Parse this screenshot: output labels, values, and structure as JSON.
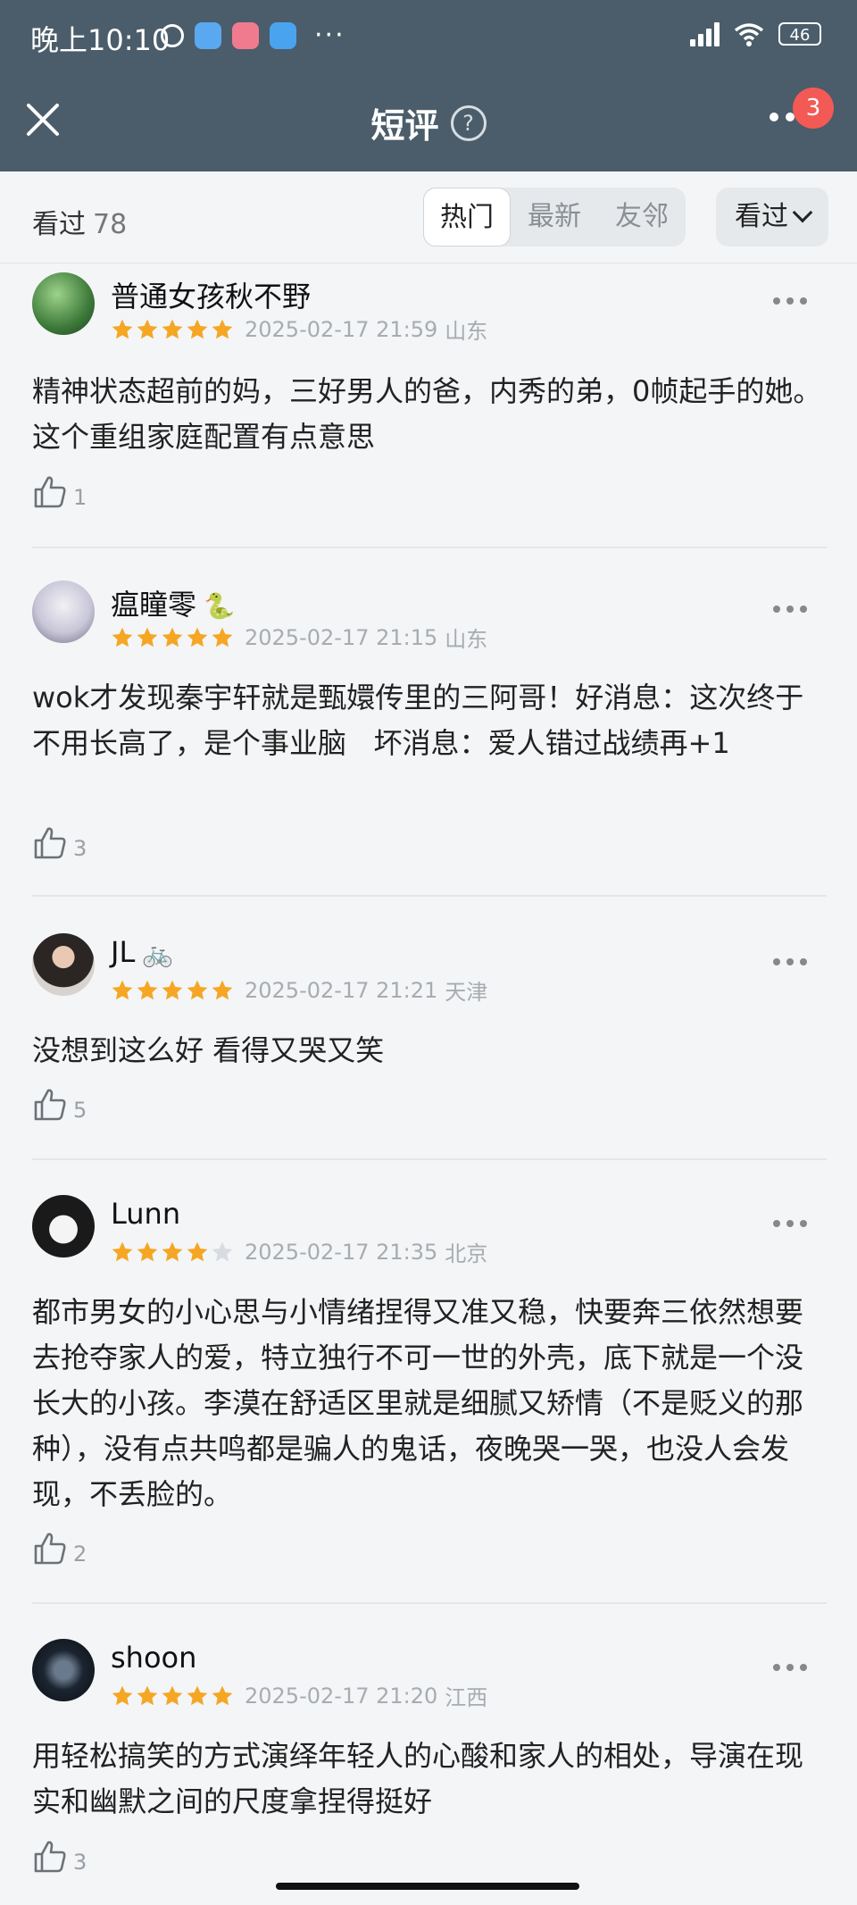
{
  "status_bar": {
    "time": "晚上10:10",
    "dots": "···",
    "battery": "46"
  },
  "header": {
    "title": "短评",
    "help_glyph": "?",
    "notification_badge": "3"
  },
  "filter_bar": {
    "seen_label": "看过",
    "seen_count": "78",
    "tabs": [
      {
        "label": "热门",
        "active": true
      },
      {
        "label": "最新",
        "active": false
      },
      {
        "label": "友邻",
        "active": false
      }
    ],
    "status_filter": "看过"
  },
  "comments": [
    {
      "username": "普通女孩秋不野",
      "extra": "",
      "rating": 5,
      "datetime": "2025-02-17 21:59",
      "region": "山东",
      "text": "精神状态超前的妈，三好男人的爸，内秀的弟，0帧起手的她。这个重组家庭配置有点意思",
      "likes": "1"
    },
    {
      "username": "瘟瞳零",
      "extra": "🐍",
      "rating": 5,
      "datetime": "2025-02-17 21:15",
      "region": "山东",
      "text": "wok才发现秦宇轩就是甄嬛传里的三阿哥！好消息：这次终于不用长高了，是个事业脑   坏消息：爱人错过战绩再+1",
      "likes": "3"
    },
    {
      "username": "JL",
      "extra": "🚲",
      "rating": 5,
      "datetime": "2025-02-17 21:21",
      "region": "天津",
      "text": "没想到这么好 看得又哭又笑",
      "likes": "5"
    },
    {
      "username": "Lunn",
      "extra": "",
      "rating": 4,
      "datetime": "2025-02-17 21:35",
      "region": "北京",
      "text": "都市男女的小心思与小情绪捏得又准又稳，快要奔三依然想要去抢夺家人的爱，特立独行不可一世的外壳，底下就是一个没长大的小孩。李漠在舒适区里就是细腻又矫情（不是贬义的那种），没有点共鸣都是骗人的鬼话，夜晚哭一哭，也没人会发现，不丢脸的。",
      "likes": "2"
    },
    {
      "username": "shoon",
      "extra": "",
      "rating": 5,
      "datetime": "2025-02-17 21:20",
      "region": "江西",
      "text": "用轻松搞笑的方式演绎年轻人的心酸和家人的相处，导演在现实和幽默之间的尺度拿捏得挺好",
      "likes": "3"
    }
  ],
  "colors": {
    "header_bg": "#4b5d6a",
    "star_on": "#f5a623",
    "star_off": "#d8dce0",
    "badge": "#f45a55"
  }
}
